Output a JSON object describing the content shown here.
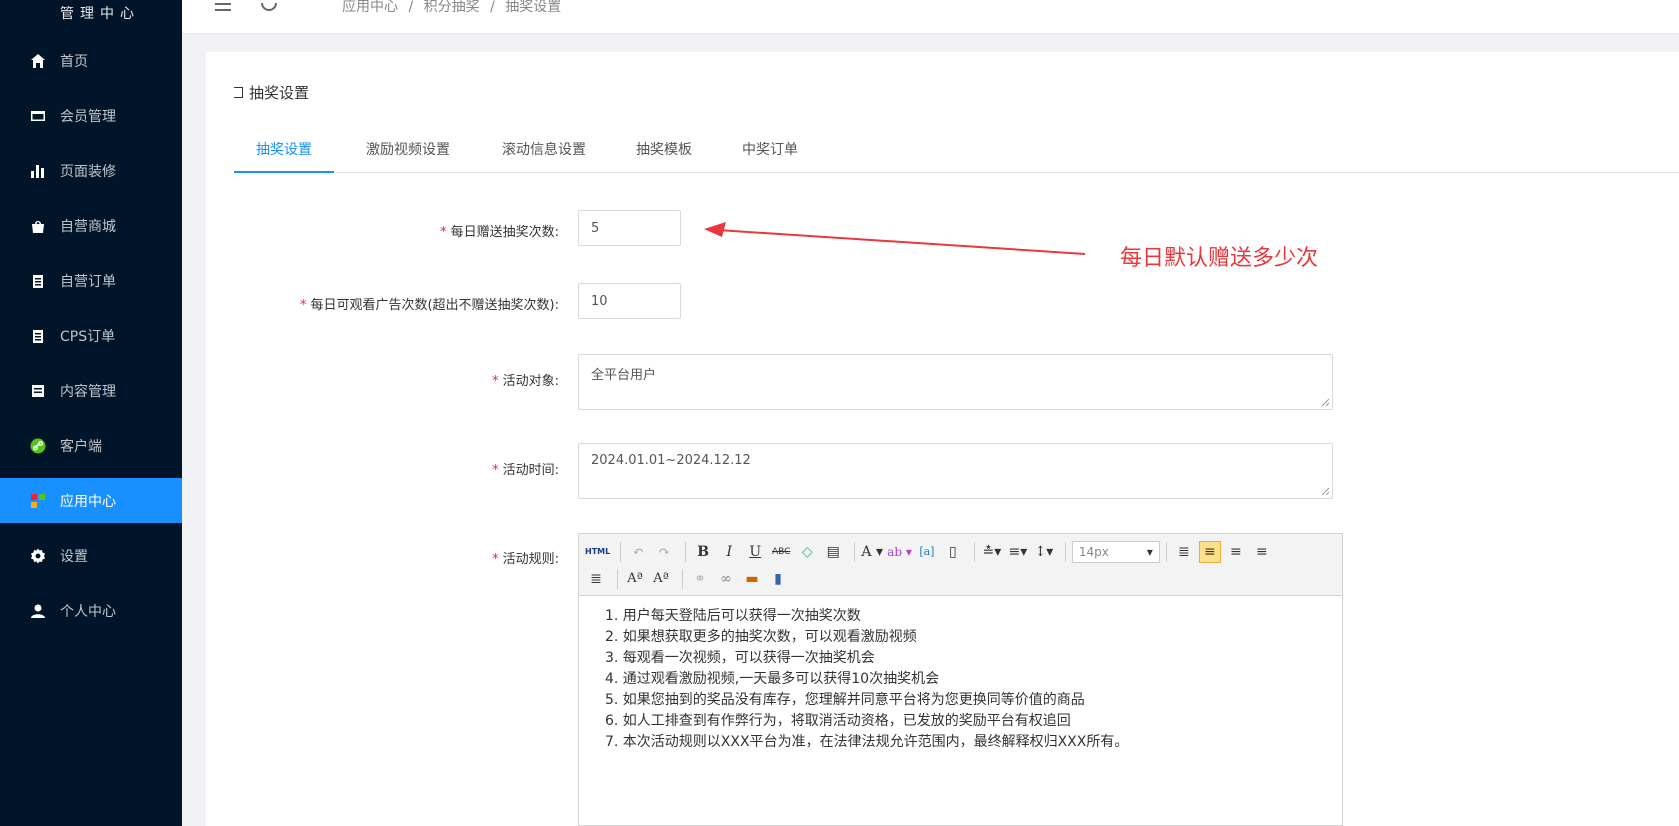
{
  "sidebar": {
    "title": "管理中心",
    "items": [
      {
        "label": "首页",
        "icon": "home-icon"
      },
      {
        "label": "会员管理",
        "icon": "card-icon"
      },
      {
        "label": "页面装修",
        "icon": "bar-chart-icon"
      },
      {
        "label": "自营商城",
        "icon": "shopping-bag-icon"
      },
      {
        "label": "自营订单",
        "icon": "clipboard-icon"
      },
      {
        "label": "CPS订单",
        "icon": "clipboard-icon"
      },
      {
        "label": "内容管理",
        "icon": "document-icon"
      },
      {
        "label": "客户端",
        "icon": "link-icon"
      },
      {
        "label": "应用中心",
        "icon": "apps-icon"
      },
      {
        "label": "设置",
        "icon": "gear-icon"
      },
      {
        "label": "个人中心",
        "icon": "user-icon"
      }
    ],
    "active_index": 8
  },
  "header": {
    "breadcrumb": [
      "应用中心",
      "/",
      "积分抽奖",
      "/",
      "抽奖设置"
    ]
  },
  "page": {
    "title": "抽奖设置",
    "tabs": [
      "抽奖设置",
      "激励视频设置",
      "滚动信息设置",
      "抽奖模板",
      "中奖订单"
    ],
    "active_tab": 0
  },
  "form": {
    "daily_gift": {
      "label": "每日赠送抽奖次数:",
      "value": "5"
    },
    "daily_ads": {
      "label": "每日可观看广告次数(超出不赠送抽奖次数):",
      "value": "10"
    },
    "target": {
      "label": "活动对象:",
      "value": "全平台用户"
    },
    "time": {
      "label": "活动时间:",
      "value": "2024.01.01~2024.12.12"
    },
    "rules": {
      "label": "活动规则:",
      "font_size": "14px",
      "lines": [
        "1. 用户每天登陆后可以获得一次抽奖次数",
        "2. 如果想获取更多的抽奖次数，可以观看激励视频",
        "3. 每观看一次视频，可以获得一次抽奖机会",
        "4. 通过观看激励视频,一天最多可以获得10次抽奖机会",
        "5. 如果您抽到的奖品没有库存，您理解并同意平台将为您更换同等价值的商品",
        "6. 如人工排查到有作弊行为，将取消活动资格，已发放的奖励平台有权追回",
        "7. 本次活动规则以XXX平台为准，在法律法规允许范围内，最终解释权归XXX所有。"
      ]
    }
  },
  "annotation": {
    "text": "每日默认赠送多少次",
    "color": "#e8383d"
  },
  "colors": {
    "sidebar_bg": "#001529",
    "accent": "#1890ff",
    "required": "#f5222d"
  }
}
